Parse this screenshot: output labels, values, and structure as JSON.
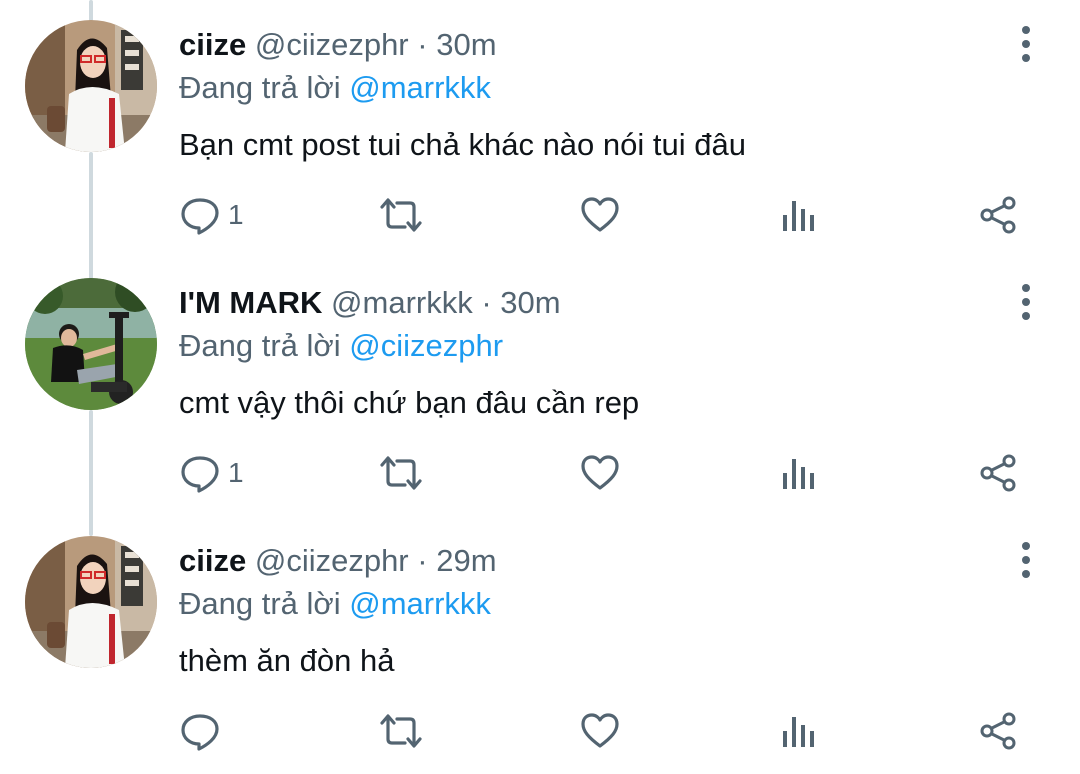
{
  "colors": {
    "text": "#0f1419",
    "secondary": "#536471",
    "link": "#1d9bf0",
    "thread_line": "#cfd9de"
  },
  "tweets": [
    {
      "name": "ciize",
      "handle": "@ciizezphr",
      "separator": "·",
      "time": "30m",
      "replying_prefix": "Đang trả lời",
      "replying_to": "@marrkkk",
      "text": "Bạn cmt post tui chả khác nào nói tui đâu",
      "reply_count": "1",
      "avatar": "woman-with-glasses-photo"
    },
    {
      "name": "I'M MARK",
      "handle": "@marrkkk",
      "separator": "·",
      "time": "30m",
      "replying_prefix": "Đang trả lời",
      "replying_to": "@ciizezphr",
      "text": "cmt vậy thôi chứ bạn đâu cần rep",
      "reply_count": "1",
      "avatar": "man-with-scooter-photo"
    },
    {
      "name": "ciize",
      "handle": "@ciizezphr",
      "separator": "·",
      "time": "29m",
      "replying_prefix": "Đang trả lời",
      "replying_to": "@marrkkk",
      "text": "thèm ăn đòn hả",
      "reply_count": "",
      "avatar": "woman-with-glasses-photo"
    }
  ],
  "icons": {
    "reply": "reply-icon",
    "retweet": "retweet-icon",
    "like": "like-icon",
    "views": "views-icon",
    "share": "share-icon",
    "more": "more-icon"
  }
}
